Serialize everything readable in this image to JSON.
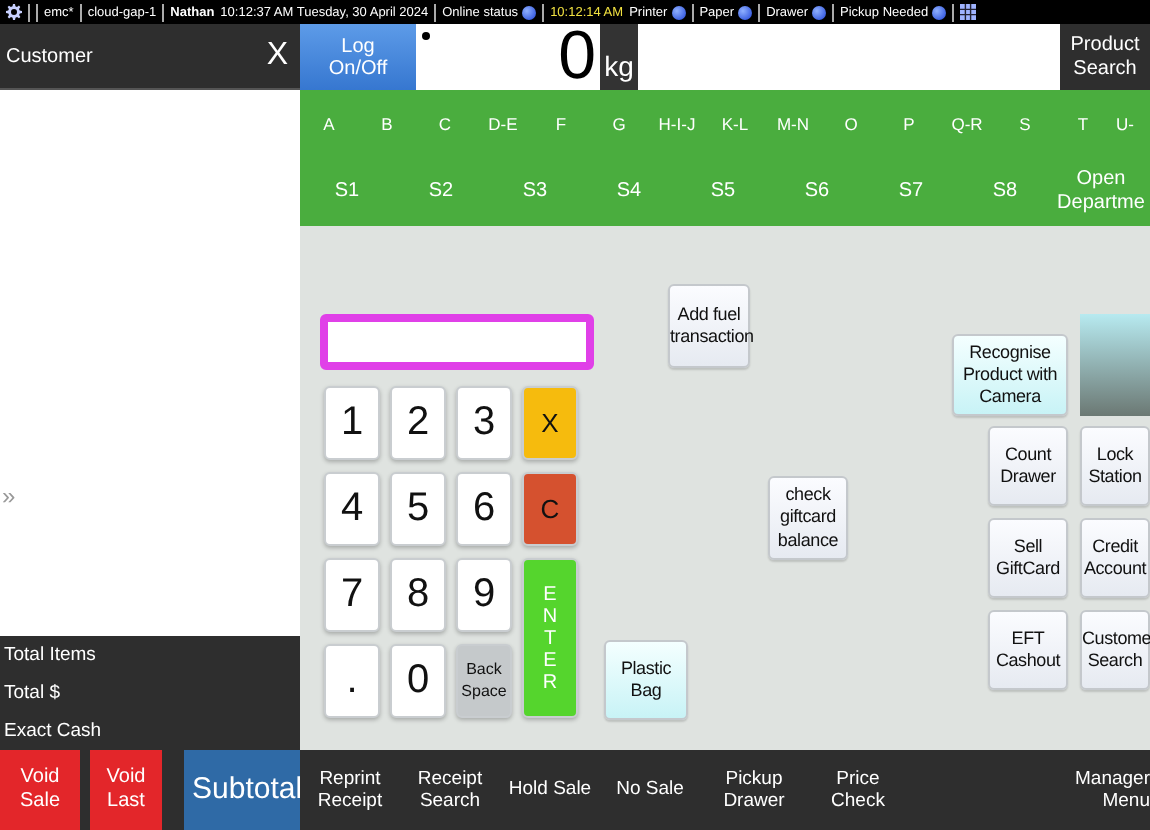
{
  "status_bar": {
    "segments": [
      {
        "kind": "text",
        "text": "emc*"
      },
      {
        "kind": "text",
        "text": "cloud-gap-1"
      },
      {
        "kind": "user",
        "text": "Nathan"
      },
      {
        "kind": "text",
        "text": "10:12:37 AM Tuesday, 30 April 2024"
      },
      {
        "kind": "indicator",
        "text": "Online status"
      },
      {
        "kind": "time",
        "text": "10:12:14 AM"
      },
      {
        "kind": "indicator",
        "text": "Printer"
      },
      {
        "kind": "indicator",
        "text": "Paper"
      },
      {
        "kind": "indicator",
        "text": "Drawer"
      },
      {
        "kind": "indicator",
        "text": "Pickup Needed"
      }
    ]
  },
  "customer_panel": {
    "title": "Customer",
    "close": "X",
    "expand": "»",
    "totals": [
      "Total Items",
      "Total $",
      "Exact Cash"
    ]
  },
  "sale_buttons": [
    {
      "kind": "danger",
      "label": "Void Sale"
    },
    {
      "kind": "danger",
      "label": "Void Last"
    },
    {
      "kind": "primary",
      "label": "Subtotal"
    }
  ],
  "log_on_button": "Log On/Off",
  "scale": {
    "weight": "0",
    "unit": "kg"
  },
  "product_search": "Product Search",
  "letters": [
    "A",
    "B",
    "C",
    "D-E",
    "F",
    "G",
    "H-I-J",
    "K-L",
    "M-N",
    "O",
    "P",
    "Q-R",
    "S",
    "T",
    "U-"
  ],
  "shortcuts": [
    "S1",
    "S2",
    "S3",
    "S4",
    "S5",
    "S6",
    "S7",
    "S8",
    "Open Departme"
  ],
  "keypad": [
    {
      "kind": "digit",
      "label": "1"
    },
    {
      "kind": "digit",
      "label": "2"
    },
    {
      "kind": "digit",
      "label": "3"
    },
    {
      "kind": "multiply",
      "label": "X"
    },
    {
      "kind": "digit",
      "label": "4"
    },
    {
      "kind": "digit",
      "label": "5"
    },
    {
      "kind": "digit",
      "label": "6"
    },
    {
      "kind": "clear",
      "label": "C"
    },
    {
      "kind": "digit",
      "label": "7"
    },
    {
      "kind": "digit",
      "label": "8"
    },
    {
      "kind": "digit",
      "label": "9"
    },
    {
      "kind": "enter",
      "label": "ENTER"
    },
    {
      "kind": "digit",
      "label": "."
    },
    {
      "kind": "digit",
      "label": "0"
    },
    {
      "kind": "backspace",
      "label": "Back Space"
    }
  ],
  "tiles": [
    {
      "kind": "plain",
      "label": "Add fuel transaction"
    },
    {
      "kind": "plain",
      "label": "check giftcard balance"
    },
    {
      "kind": "highlight",
      "label": "Plastic Bag"
    },
    {
      "kind": "highlight",
      "label": "Recognise Product with Camera"
    },
    {
      "kind": "preview"
    },
    {
      "kind": "plain",
      "label": "Count Drawer"
    },
    {
      "kind": "plain",
      "label": "Lock Station"
    },
    {
      "kind": "plain",
      "label": "Sell GiftCard"
    },
    {
      "kind": "plain",
      "label": "Credit Account"
    },
    {
      "kind": "plain",
      "label": "EFT Cashout"
    },
    {
      "kind": "plain",
      "label": "Custome Search"
    }
  ],
  "bottom_bar": [
    "Reprint Receipt",
    "Receipt Search",
    "Hold Sale",
    "No Sale",
    "Pickup Drawer",
    "Price Check"
  ],
  "manager_menu": "Manager Menu"
}
